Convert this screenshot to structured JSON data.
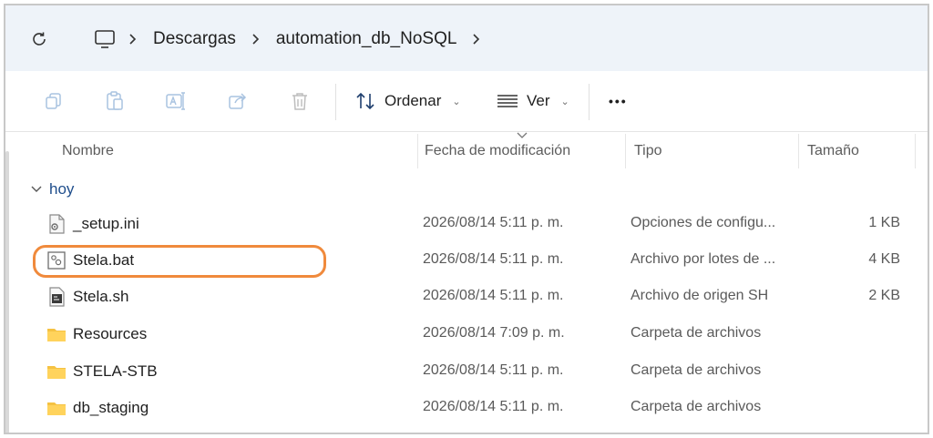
{
  "addressbar": {
    "breadcrumbs": [
      "Descargas",
      "automation_db_NoSQL"
    ]
  },
  "toolbar": {
    "sort_label": "Ordenar",
    "view_label": "Ver",
    "more_label": "•••"
  },
  "columns": {
    "name": "Nombre",
    "modified": "Fecha de modificación",
    "type": "Tipo",
    "size": "Tamaño"
  },
  "group": {
    "label": "hoy"
  },
  "files": [
    {
      "name": "_setup.ini",
      "modified": "2026/08/14 5:11 p. m.",
      "type": "Opciones de configu...",
      "size": "1 KB",
      "icon": "ini-file-icon"
    },
    {
      "name": "Stela.bat",
      "modified": "2026/08/14 5:11 p. m.",
      "type": "Archivo por lotes de ...",
      "size": "4 KB",
      "icon": "batch-file-icon"
    },
    {
      "name": "Stela.sh",
      "modified": "2026/08/14 5:11 p. m.",
      "type": "Archivo de origen SH",
      "size": "2 KB",
      "icon": "script-file-icon"
    },
    {
      "name": "Resources",
      "modified": "2026/08/14 7:09 p. m.",
      "type": "Carpeta de archivos",
      "size": "",
      "icon": "folder-icon"
    },
    {
      "name": "STELA-STB",
      "modified": "2026/08/14 5:11 p. m.",
      "type": "Carpeta de archivos",
      "size": "",
      "icon": "folder-icon"
    },
    {
      "name": "db_staging",
      "modified": "2026/08/14 5:11 p. m.",
      "type": "Carpeta de archivos",
      "size": "",
      "icon": "folder-icon"
    }
  ],
  "colors": {
    "address_bg": "#eef3f9",
    "highlight": "#f08a3c",
    "folder": "#f5c242",
    "group_text": "#1f4e8c"
  }
}
